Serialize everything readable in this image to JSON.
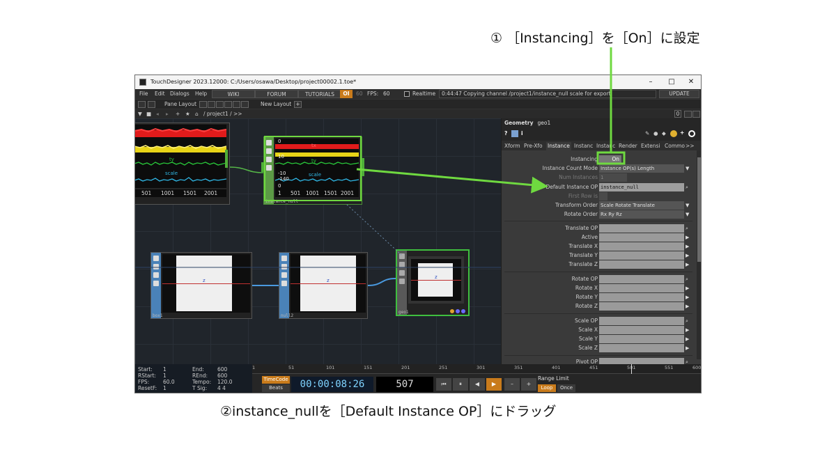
{
  "annotations": {
    "step1": "① ［Instancing］を［On］に設定",
    "step2": "②instance_nullを［Default Instance OP］にドラッグ"
  },
  "window": {
    "title": "TouchDesigner 2023.12000: C:/Users/osawa/Desktop/project00002.1.toe*",
    "minimize": "–",
    "maximize": "□",
    "close": "✕"
  },
  "menubar": {
    "items": [
      "File",
      "Edit",
      "Dialogs",
      "Help"
    ],
    "wiki": "WIKI",
    "forum": "FORUM",
    "tutorials": "TUTORIALS",
    "oi": "OI",
    "sixty": "60",
    "fps_label": "FPS:",
    "fps_value": "60",
    "realtime": "Realtime",
    "status": "0:44:47 Copying channel /project1/instance_null scale for export.",
    "update": "UPDATE"
  },
  "toolbar": {
    "pane_layout": "Pane Layout",
    "new_layout": "New Layout",
    "path": "/ project1 / >>",
    "zero": "0"
  },
  "network": {
    "chop1": {
      "ticks": [
        "501",
        "1001",
        "1501",
        "2001"
      ],
      "channels": [
        "ty",
        "scale"
      ]
    },
    "instance_null": {
      "label": "instance_null",
      "ticks": [
        "1",
        "501",
        "1001",
        "1501",
        "2001"
      ],
      "channels": [
        "tx",
        "ty",
        "scale"
      ],
      "ylabels": [
        "0",
        "10",
        "-10",
        "-140",
        "0"
      ]
    },
    "box1": {
      "label": "box1",
      "axis": "z"
    },
    "null2": {
      "label": "null2",
      "axis": "z"
    },
    "geo1": {
      "label": "geo1",
      "axis": "z"
    }
  },
  "params": {
    "header_type": "Geometry",
    "header_name": "geo1",
    "tabs": [
      "Xform",
      "Pre-Xfo",
      "Instance",
      "Instanc",
      "Instanc",
      "Render",
      "Extensi",
      "Commo",
      ">>"
    ],
    "rows": {
      "instancing": {
        "label": "Instancing",
        "value": "On"
      },
      "count_mode": {
        "label": "Instance Count Mode",
        "value": "Instance OP(s) Length"
      },
      "num_instances": {
        "label": "Num Instances",
        "value": "1"
      },
      "default_op": {
        "label": "Default Instance OP",
        "value": "instance_null"
      },
      "first_row": {
        "label": "First Row is"
      },
      "transform_order": {
        "label": "Transform Order",
        "value": "Scale Rotate Translate"
      },
      "rotate_order": {
        "label": "Rotate Order",
        "value": "Rx Ry Rz"
      },
      "translate_op": {
        "label": "Translate OP"
      },
      "active": {
        "label": "Active"
      },
      "translate_x": {
        "label": "Translate X"
      },
      "translate_y": {
        "label": "Translate Y"
      },
      "translate_z": {
        "label": "Translate Z"
      },
      "rotate_op": {
        "label": "Rotate OP"
      },
      "rotate_x": {
        "label": "Rotate X"
      },
      "rotate_y": {
        "label": "Rotate Y"
      },
      "rotate_z": {
        "label": "Rotate Z"
      },
      "scale_op": {
        "label": "Scale OP"
      },
      "scale_x": {
        "label": "Scale X"
      },
      "scale_y": {
        "label": "Scale Y"
      },
      "scale_z": {
        "label": "Scale Z"
      },
      "pivot_op": {
        "label": "Pivot OP"
      }
    }
  },
  "timeline": {
    "start_k": "Start:",
    "start_v": "1",
    "end_k": "End:",
    "end_v": "600",
    "rstart_k": "RStart:",
    "rstart_v": "1",
    "rend_k": "REnd:",
    "rend_v": "600",
    "fps_k": "FPS:",
    "fps_v": "60.0",
    "tempo_k": "Tempo:",
    "tempo_v": "120.0",
    "resetf_k": "ResetF:",
    "resetf_v": "1",
    "tsig_k": "T Sig:",
    "tsig_v": "4    4",
    "ruler": [
      "1",
      "51",
      "101",
      "151",
      "201",
      "251",
      "301",
      "351",
      "401",
      "451",
      "501",
      "551",
      "600"
    ],
    "timecode": "TimeCode",
    "beats": "Beats",
    "time": "00:00:08:26",
    "frame": "507",
    "range_limit": "Range Limit",
    "loop": "Loop",
    "once": "Once"
  },
  "colors": {
    "green_arrow": "#6fd940",
    "param_bg": "#3a3a3a",
    "orange": "#c97b1b"
  }
}
